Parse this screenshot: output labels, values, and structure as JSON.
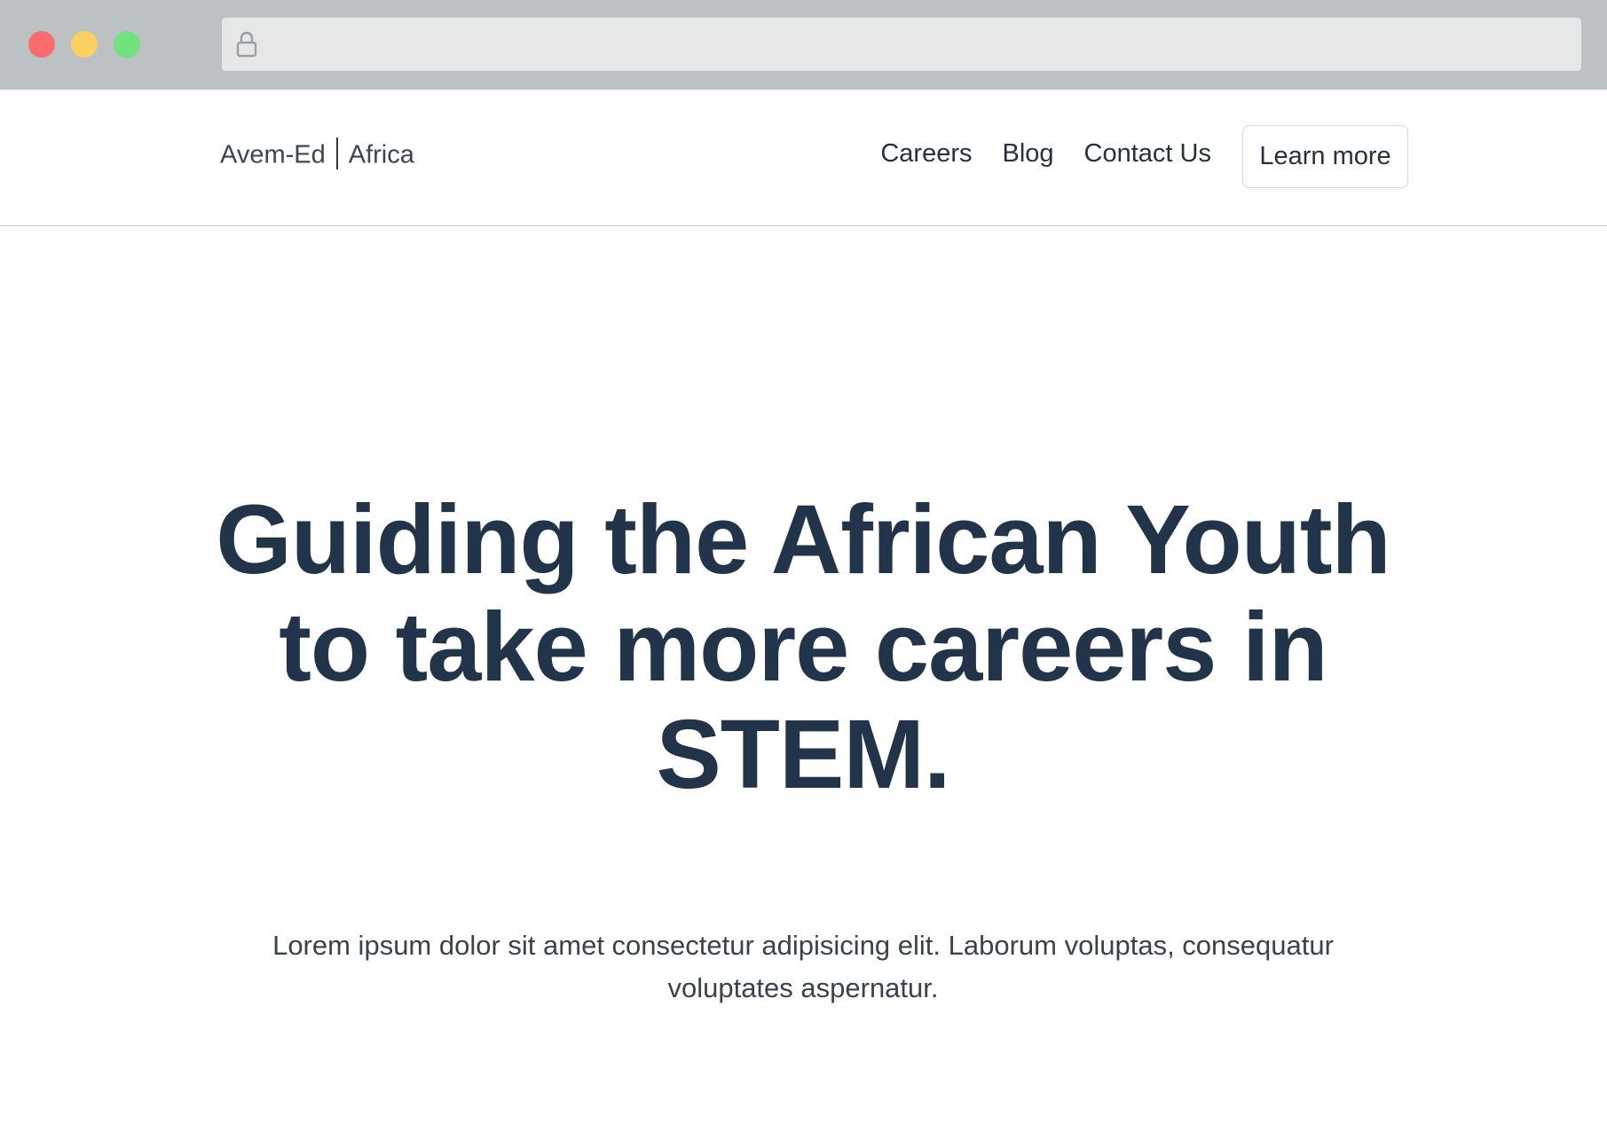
{
  "browser": {
    "address_value": ""
  },
  "icons": {
    "lock": "lock-icon"
  },
  "colors": {
    "titlebar": "#bcc1c4",
    "close": "#f96e6c",
    "minimize": "#fbd061",
    "maximize": "#71e27c",
    "heading": "#22344a"
  },
  "navbar": {
    "brand_left": "Avem-Ed",
    "brand_right": "Africa",
    "links": [
      "Careers",
      "Blog",
      "Contact Us"
    ],
    "cta_label": "Learn more"
  },
  "hero": {
    "title": "Guiding the African Youth to take more careers in STEM.",
    "subtitle": "Lorem ipsum dolor sit amet consectetur adipisicing elit. Laborum voluptas, consequatur voluptates aspernatur."
  }
}
